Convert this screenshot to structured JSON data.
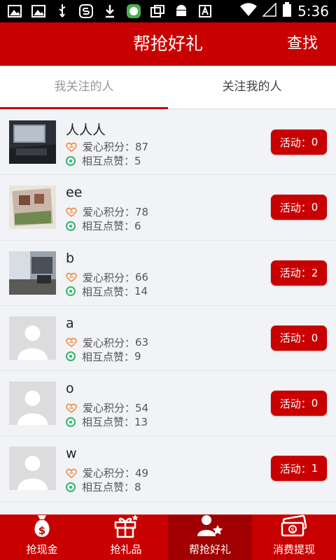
{
  "status_bar": {
    "time": "5:36",
    "icons": [
      "image-icon",
      "image-icon",
      "usb-icon",
      "s-app-icon",
      "download-icon",
      "green-app-icon",
      "copy-icon",
      "android-icon",
      "a-icon"
    ],
    "right_icons": [
      "wifi-icon",
      "signal-icon",
      "battery-icon"
    ]
  },
  "header": {
    "title": "帮抢好礼",
    "search_label": "查找"
  },
  "tabs": [
    {
      "label": "我关注的人",
      "active": true
    },
    {
      "label": "关注我的人",
      "active": false
    }
  ],
  "list": {
    "points_label": "爱心积分：",
    "likes_label": "相互点赞：",
    "activity_prefix": "活动：",
    "items": [
      {
        "name": "人人人",
        "points": "87",
        "likes": "5",
        "activity": "0",
        "avatar": "photo-laptop"
      },
      {
        "name": "ee",
        "points": "78",
        "likes": "6",
        "activity": "0",
        "avatar": "photo-house"
      },
      {
        "name": "b",
        "points": "66",
        "likes": "14",
        "activity": "2",
        "avatar": "photo-room"
      },
      {
        "name": "a",
        "points": "63",
        "likes": "9",
        "activity": "0",
        "avatar": "default"
      },
      {
        "name": "o",
        "points": "54",
        "likes": "13",
        "activity": "0",
        "avatar": "default"
      },
      {
        "name": "w",
        "points": "49",
        "likes": "8",
        "activity": "1",
        "avatar": "default"
      }
    ]
  },
  "bottom_nav": [
    {
      "label": "抢现金",
      "icon": "money-bag-icon",
      "active": false
    },
    {
      "label": "抢礼品",
      "icon": "gift-icon",
      "active": false
    },
    {
      "label": "帮抢好礼",
      "icon": "user-star-icon",
      "active": true
    },
    {
      "label": "消费提现",
      "icon": "cash-icon",
      "active": false
    }
  ],
  "colors": {
    "brand_red": "#c90000",
    "nav_active": "#a00000",
    "heart_orange": "#f08a3c",
    "like_green": "#2fb86a"
  }
}
